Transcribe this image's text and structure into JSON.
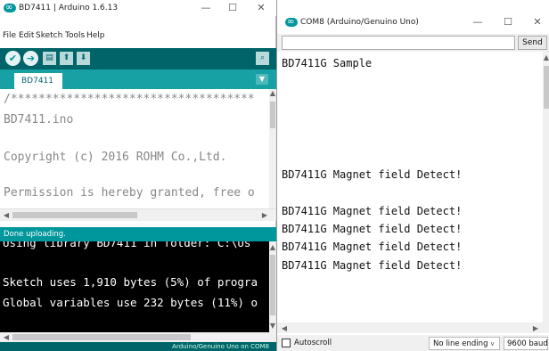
{
  "ide": {
    "title": "BD7411 | Arduino 1.6.13",
    "menu": [
      "File",
      "Edit",
      "Sketch",
      "Tools",
      "Help"
    ],
    "tab_label": "BD7411",
    "code_lines": [
      "/***********************************",
      "  BD7411.ino",
      "",
      " Copyright (c) 2016 ROHM Co.,Ltd.",
      "",
      " Permission is hereby granted, free o",
      "  ...  ..  ..  ...  ..  ..  ..  ..  .."
    ],
    "status": "Done uploading.",
    "console_lines": [
      "Using library BD7411 in folder: C:\\Us",
      "",
      "Sketch uses 1,910 bytes (5%) of progra",
      "Global variables use 232 bytes (11%) o"
    ],
    "footer": "Arduino/Genuino Uno on COM8"
  },
  "serial": {
    "title": "COM8 (Arduino/Genuino Uno)",
    "send_label": "Send",
    "input_value": "",
    "output_lines": [
      "BD7411G Sample",
      "",
      "",
      "",
      "",
      "",
      "BD7411G Magnet field Detect!",
      "",
      "BD7411G Magnet field Detect!",
      "BD7411G Magnet field Detect!",
      "BD7411G Magnet field Detect!",
      "BD7411G Magnet field Detect!"
    ],
    "autoscroll_label": "Autoscroll",
    "autoscroll_checked": false,
    "line_ending": "No line ending",
    "baud": "9600 baud"
  },
  "colors": {
    "teal_dark": "#006468",
    "teal": "#00979c",
    "editor_bg": "#ffffff",
    "console_bg": "#000000"
  }
}
